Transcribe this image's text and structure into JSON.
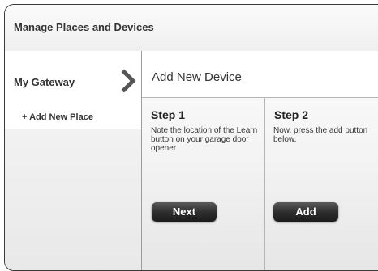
{
  "header": {
    "title": "Manage Places and Devices"
  },
  "sidebar": {
    "items": [
      {
        "label": "My Gateway",
        "icon": "chevron-right-icon"
      },
      {
        "label": "+ Add New Place"
      }
    ]
  },
  "main": {
    "heading": "Add New Device",
    "steps": [
      {
        "title": "Step 1",
        "text": "Note the location of the Learn button on your garage door opener",
        "button": "Next"
      },
      {
        "title": "Step 2",
        "text_lines": [
          "Now, press the add button",
          "below."
        ],
        "button": "Add"
      }
    ]
  },
  "colors": {
    "button_dark": "#2e2e2e",
    "border": "#3a3a3a"
  }
}
